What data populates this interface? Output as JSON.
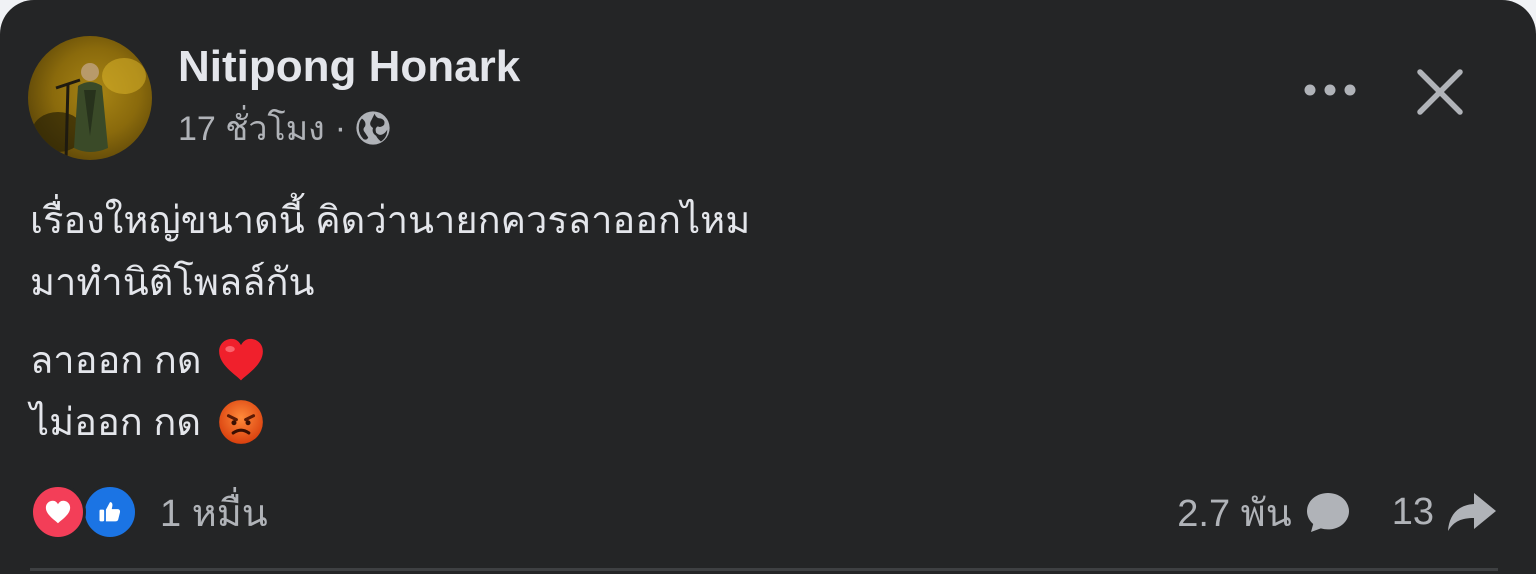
{
  "post": {
    "author": {
      "name": "Nitipong Honark"
    },
    "timestamp": "17 ชั่วโมง",
    "separator": "·",
    "privacy_icon": "globe-icon",
    "lines": [
      "เรื่องใหญ่ขนาดนี้ คิดว่านายกควรลาออกไหม",
      "มาทำนิติโพลล์กัน"
    ],
    "poll": [
      {
        "text": "ลาออก กด",
        "emoji": "red-heart-emoji"
      },
      {
        "text": "ไม่ออก กด",
        "emoji": "angry-face-emoji"
      }
    ]
  },
  "stats": {
    "reaction_icons": [
      "love-reaction-icon",
      "like-reaction-icon"
    ],
    "reactions_count": "1 หมื่น",
    "comments_count": "2.7 พัน",
    "shares_count": "13"
  },
  "toolbar": {
    "more_icon": "more-options-icon",
    "close_icon": "close-icon"
  },
  "colors": {
    "card_background": "#242526",
    "primary_text": "#e4e6eb",
    "secondary_text": "#b0b3b8",
    "love": "#f33e58",
    "like": "#1b74e4",
    "angry": "#e8541c"
  }
}
